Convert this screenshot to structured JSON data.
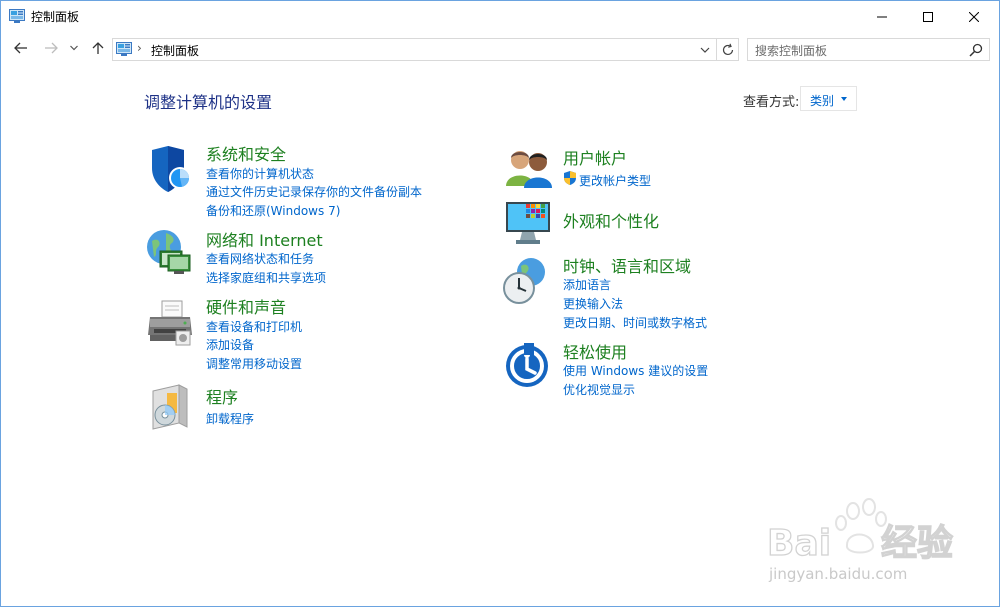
{
  "window": {
    "title": "控制面板"
  },
  "address_bar": {
    "path_segment": "控制面板",
    "search_placeholder": "搜索控制面板"
  },
  "main": {
    "heading": "调整计算机的设置",
    "view_by_label": "查看方式:",
    "view_by_value": "类别"
  },
  "categories": {
    "system_security": {
      "title": "系统和安全",
      "links": [
        "查看你的计算机状态",
        "通过文件历史记录保存你的文件备份副本",
        "备份和还原(Windows 7)"
      ]
    },
    "network": {
      "title": "网络和 Internet",
      "links": [
        "查看网络状态和任务",
        "选择家庭组和共享选项"
      ]
    },
    "hardware": {
      "title": "硬件和声音",
      "links": [
        "查看设备和打印机",
        "添加设备",
        "调整常用移动设置"
      ]
    },
    "programs": {
      "title": "程序",
      "links": [
        "卸载程序"
      ]
    },
    "user_accounts": {
      "title": "用户帐户",
      "links": [
        "更改帐户类型"
      ]
    },
    "appearance": {
      "title": "外观和个性化",
      "links": []
    },
    "clock_region": {
      "title": "时钟、语言和区域",
      "links": [
        "添加语言",
        "更换输入法",
        "更改日期、时间或数字格式"
      ]
    },
    "ease_of_access": {
      "title": "轻松使用",
      "links": [
        "使用 Windows 建议的设置",
        "优化视觉显示"
      ]
    }
  },
  "watermark": {
    "brand": "Baidu经验",
    "url": "jingyan.baidu.com"
  },
  "colors": {
    "title_text": "#1e3287",
    "category_title": "#1d8020",
    "link": "#0066cc",
    "window_border": "#6aa3e0"
  }
}
